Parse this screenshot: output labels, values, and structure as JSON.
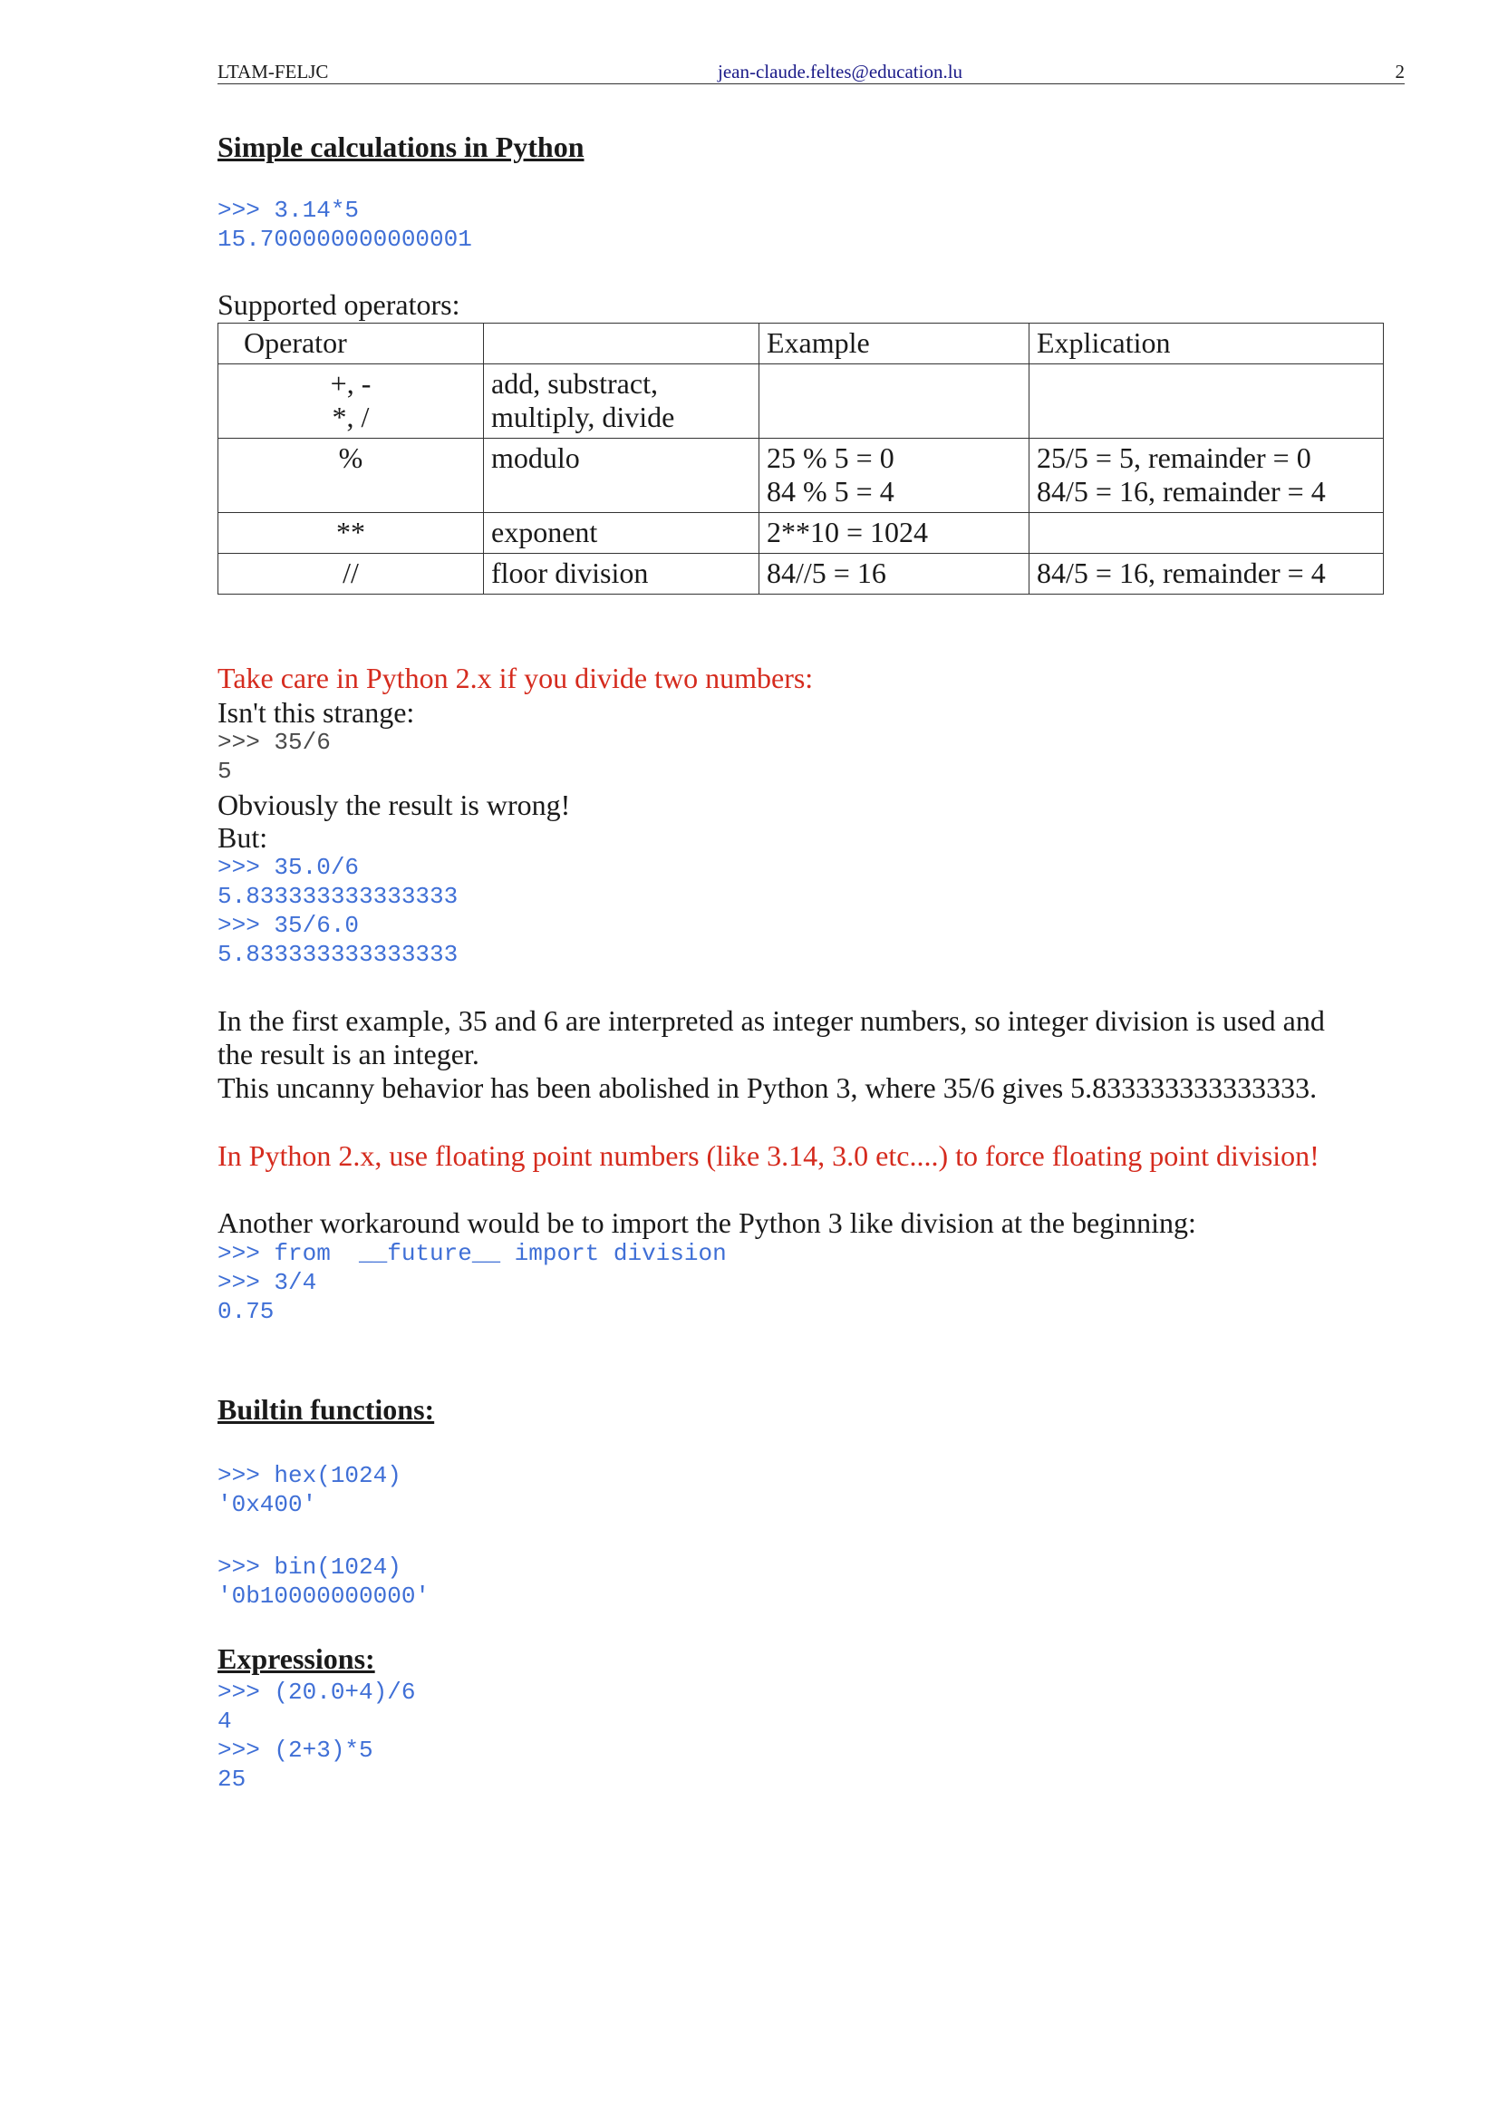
{
  "header": {
    "left": "LTAM-FELJC",
    "email": "jean-claude.feltes@education.lu",
    "page_number": "2"
  },
  "section1": {
    "title": "Simple calculations in Python",
    "code": ">>> 3.14*5\n15.700000000000001",
    "supported_label": "Supported operators:"
  },
  "table": {
    "headers": [
      "Operator",
      "",
      "Example",
      "Explication"
    ],
    "rows": [
      {
        "operator": "+, -\n*, /",
        "name": "add, substract,\nmultiply, divide",
        "example": "",
        "explication": ""
      },
      {
        "operator": "%",
        "name": "modulo",
        "example": "25 % 5 = 0\n84 % 5 = 4",
        "explication": "25/5 = 5, remainder = 0\n84/5 = 16, remainder = 4"
      },
      {
        "operator": "**",
        "name": "exponent",
        "example": "2**10 = 1024",
        "explication": ""
      },
      {
        "operator": "//",
        "name": "floor division",
        "example": "84//5 = 16",
        "explication": "84/5 = 16, remainder = 4"
      }
    ]
  },
  "division": {
    "warning": "Take care in Python 2.x if you divide two numbers:",
    "strange": "Isn't this strange:",
    "code1": ">>> 35/6\n5",
    "wrong": "Obviously the result is wrong!",
    "but": "But:",
    "code2": ">>> 35.0/6\n5.833333333333333\n>>> 35/6.0\n5.833333333333333",
    "explain1": "In the first example, 35 and 6 are interpreted as integer numbers, so integer division is used and",
    "explain2": "the result is an integer.",
    "explain3": "This uncanny behavior has been abolished in Python 3, where 35/6 gives 5.833333333333333.",
    "tip": "In Python 2.x, use floating point numbers (like 3.14, 3.0 etc....) to force floating point division!",
    "workaround": "Another  workaround would be to import the Python 3 like division at the beginning:",
    "code3": ">>> from  __future__ import division\n>>> 3/4\n0.75"
  },
  "builtins": {
    "title": "Builtin functions:",
    "code1": ">>> hex(1024)\n'0x400'",
    "code2": ">>> bin(1024)\n'0b10000000000'"
  },
  "expressions": {
    "title": "Expressions:",
    "code": ">>> (20.0+4)/6\n4\n>>> (2+3)*5\n25"
  },
  "colors": {
    "code_blue": "#3f6fd6",
    "warning_red": "#d52b1e",
    "text": "#1a1a1a"
  }
}
